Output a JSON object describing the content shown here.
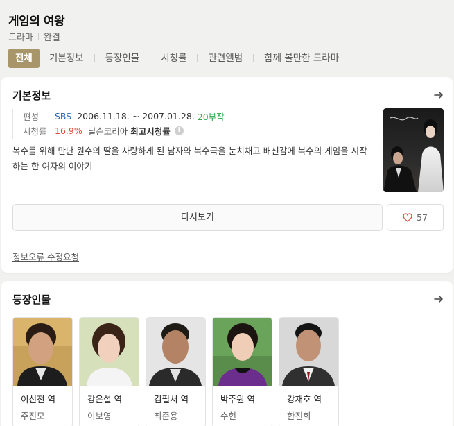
{
  "header": {
    "title": "게임의 여왕",
    "genre": "드라마",
    "status": "완결"
  },
  "tabs": [
    {
      "label": "전체",
      "active": true
    },
    {
      "label": "기본정보"
    },
    {
      "label": "등장인물"
    },
    {
      "label": "시청률"
    },
    {
      "label": "관련앨범"
    },
    {
      "label": "함께 볼만한 드라마"
    }
  ],
  "basic_info": {
    "section_title": "기본정보",
    "schedule_label": "편성",
    "channel": "SBS",
    "date_range": "2006.11.18. ~ 2007.01.28.",
    "episodes": "20부작",
    "rating_label": "시청률",
    "rating_value": "16.9%",
    "rating_source": "닐슨코리아",
    "rating_note": "최고시청률",
    "info_icon_glyph": "i",
    "synopsis": "복수를 위해 만난 원수의 딸을 사랑하게 된 남자와 복수극을 눈치채고 배신감에 복수의 게임을 시작하는 한 여자의 이야기",
    "replay_label": "다시보기",
    "like_count": "57",
    "report_label": "정보오류 수정요청"
  },
  "cast_section": {
    "section_title": "등장인물",
    "members": [
      {
        "role": "이신전 역",
        "actor": "주진모"
      },
      {
        "role": "강은설 역",
        "actor": "이보영"
      },
      {
        "role": "김필서 역",
        "actor": "최준용"
      },
      {
        "role": "박주원 역",
        "actor": "수현"
      },
      {
        "role": "강재호 역",
        "actor": "한진희"
      }
    ]
  },
  "colors": {
    "accent_tab": "#a8966a",
    "channel": "#2866b0",
    "episodes": "#2ea94b",
    "rating": "#e4473c",
    "heart": "#e4473c"
  },
  "icons": {
    "arrow": "arrow-right-icon",
    "heart": "heart-outline-icon",
    "info": "info-icon"
  }
}
